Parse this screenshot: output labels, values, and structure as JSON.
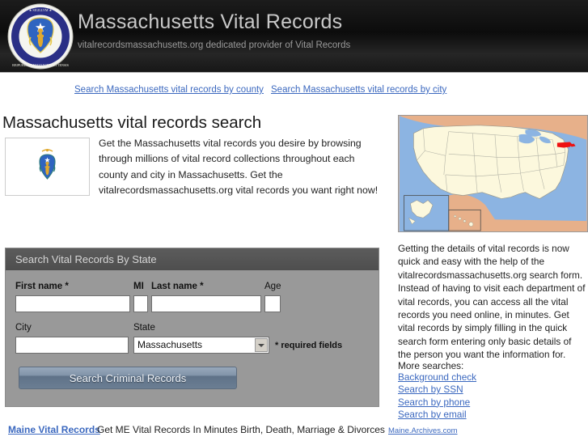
{
  "header": {
    "title": "Massachusetts Vital Records",
    "tagline": "vitalrecordsmassachusetts.org dedicated provider of Vital Records",
    "seal_icon": "massachusetts-state-seal-icon"
  },
  "nav": {
    "by_county": "Search Massachusetts vital records by county",
    "by_city": "Search Massachusetts vital records by city"
  },
  "main": {
    "page_title": "Massachusetts vital records search",
    "flag_icon": "massachusetts-state-flag-icon",
    "intro_text": "Get the Massachusetts vital records you desire by browsing through millions of vital record collections throughout each county and city in Massachusetts. Get the vitalrecordsmassachusetts.org vital records you want right now!",
    "map": {
      "icon": "united-states-map-icon",
      "highlighted_state": "Massachusetts",
      "highlight_color": "#ee1111",
      "land_color": "#fcf8dd",
      "water_color": "#8cb4e2",
      "foreign_color": "#e7b08a"
    }
  },
  "form": {
    "panel_title": "Search Vital Records By State",
    "fields": {
      "first_name": {
        "label": "First name *",
        "value": "",
        "placeholder": ""
      },
      "mi": {
        "label": "MI",
        "value": "",
        "placeholder": ""
      },
      "last_name": {
        "label": "Last name *",
        "value": "",
        "placeholder": ""
      },
      "age": {
        "label": "Age",
        "value": "",
        "placeholder": ""
      },
      "city": {
        "label": "City",
        "value": "",
        "placeholder": ""
      },
      "state": {
        "label": "State",
        "value": "Massachusetts",
        "options": [
          "Massachusetts"
        ]
      }
    },
    "required_note": "* required fields",
    "submit_label": "Search Criminal Records"
  },
  "sidebar": {
    "body_text": "Getting the details of vital records is now quick and easy with the help of the vitalrecordsmassachusetts.org search form. Instead of having to visit each department of vital records, you can access all the vital records you need online, in minutes. Get vital records by simply filling in the quick search form entering only basic details of the person you want the information for.",
    "more_label": "More searches:",
    "more_links": [
      "Background check",
      "Search by SSN",
      "Search by phone",
      "Search by email"
    ]
  },
  "footer": {
    "link": "Maine Vital Records",
    "text": "Get ME Vital Records In Minutes Birth, Death, Marriage & Divorces",
    "credit": "Maine.Archives.com"
  },
  "colors": {
    "header_bg": "#141414",
    "link": "#3b68bf",
    "panel_header_bg": "#555555",
    "panel_body_bg": "#999999",
    "button_blue": "#7a8da2"
  }
}
